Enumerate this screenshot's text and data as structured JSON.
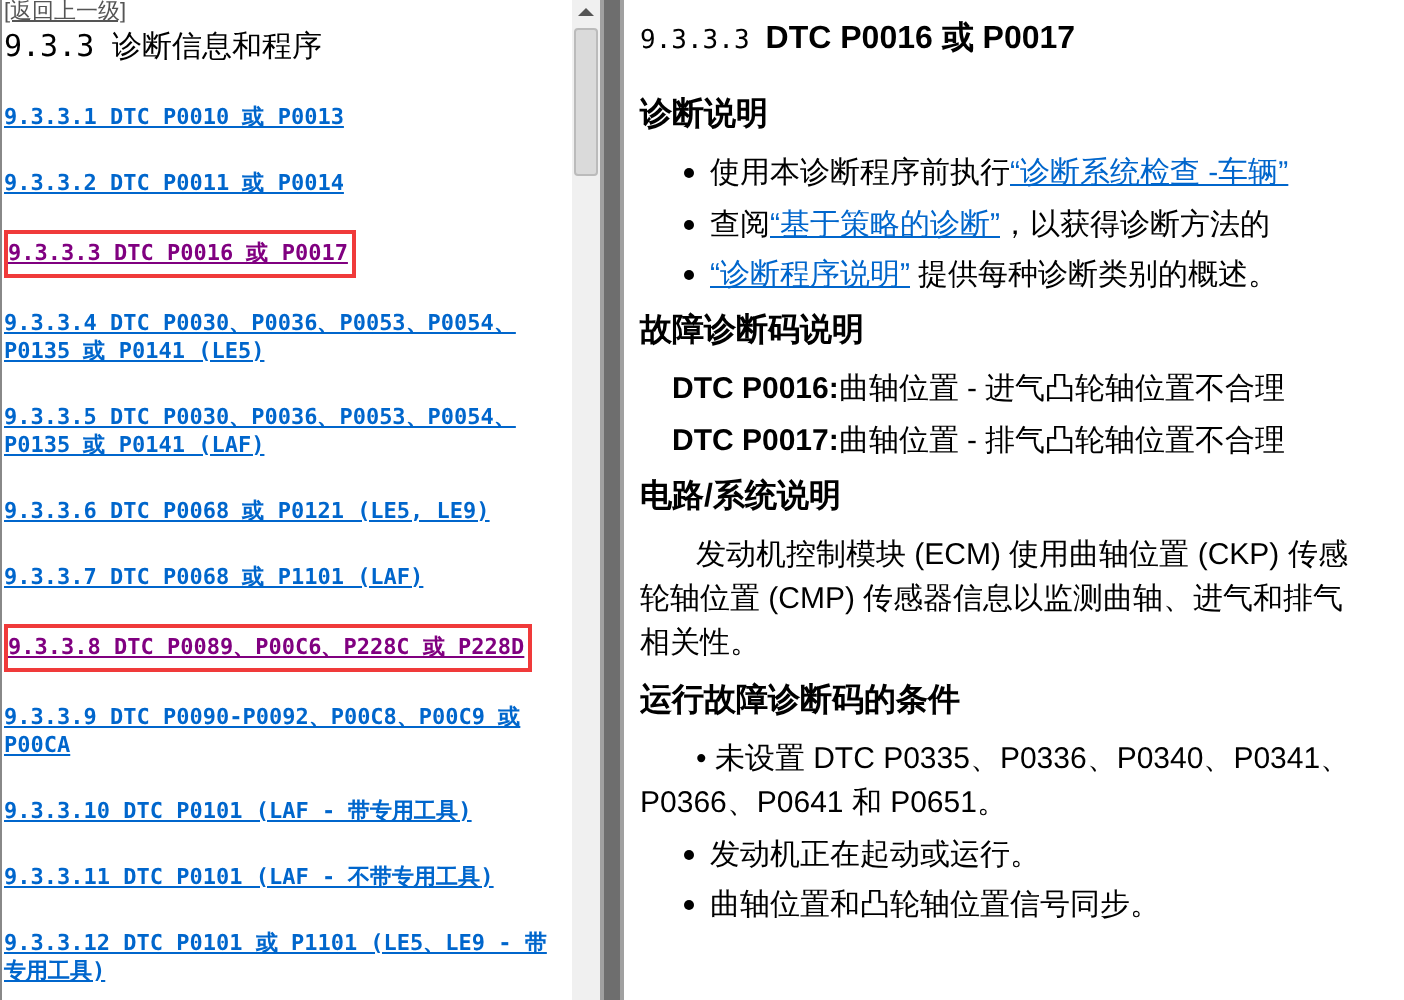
{
  "back_link": "[返回上一级]",
  "toc_title": "9.3.3 诊断信息和程序",
  "toc_items": [
    {
      "label": "9.3.3.1 DTC P0010 或 P0013",
      "selected": false
    },
    {
      "label": "9.3.3.2 DTC P0011 或 P0014",
      "selected": false
    },
    {
      "label": "9.3.3.3 DTC P0016 或 P0017",
      "selected": true
    },
    {
      "label": "9.3.3.4 DTC P0030、P0036、P0053、P0054、P0135 或 P0141 (LE5)",
      "selected": false
    },
    {
      "label": "9.3.3.5 DTC P0030、P0036、P0053、P0054、P0135 或 P0141 (LAF)",
      "selected": false
    },
    {
      "label": "9.3.3.6 DTC P0068 或 P0121 (LE5, LE9)",
      "selected": false
    },
    {
      "label": "9.3.3.7 DTC P0068 或 P1101 (LAF)",
      "selected": false
    },
    {
      "label": "9.3.3.8 DTC P0089、P00C6、P228C 或 P228D",
      "selected": true
    },
    {
      "label": "9.3.3.9 DTC P0090-P0092、P00C8、P00C9 或 P00CA",
      "selected": false
    },
    {
      "label": "9.3.3.10 DTC P0101 (LAF - 带专用工具)",
      "selected": false
    },
    {
      "label": "9.3.3.11 DTC P0101 (LAF - 不带专用工具)",
      "selected": false
    },
    {
      "label": "9.3.3.12 DTC P0101 或 P1101 (LE5、LE9 - 带专用工具)",
      "selected": false
    }
  ],
  "article": {
    "number": "9.3.3.3",
    "title": "DTC P0016 或  P0017",
    "sections": [
      {
        "heading": "诊断说明",
        "blocks": [
          {
            "kind": "bullet",
            "text": "使用本诊断程序前执行",
            "link": "“诊断系统检查 -车辆”"
          },
          {
            "kind": "bullet",
            "text": "查阅",
            "link": "“基于策略的诊断”",
            "after": "，以获得诊断方法的"
          },
          {
            "kind": "bullet",
            "link": "“诊断程序说明”",
            "after": " 提供每种诊断类别的概述。"
          }
        ]
      },
      {
        "heading": "故障诊断码说明",
        "blocks": [
          {
            "kind": "code",
            "code": "DTC P0016:",
            "text": "曲轴位置  - 进气凸轮轴位置不合理"
          },
          {
            "kind": "code",
            "code": "DTC P0017:",
            "text": "曲轴位置  - 排气凸轮轴位置不合理"
          }
        ]
      },
      {
        "heading": "电路/系统说明",
        "blocks": [
          {
            "kind": "para",
            "lines": [
              "发动机控制模块 (ECM) 使用曲轴位置 (CKP) 传感",
              "轮轴位置 (CMP) 传感器信息以监测曲轴、进气和排气",
              "相关性。"
            ]
          }
        ]
      },
      {
        "heading": "运行故障诊断码的条件",
        "blocks": [
          {
            "kind": "para_bullet",
            "lines": [
              "• 未设置 DTC P0335、P0336、P0340、P0341、",
              "P0366、P0641 和 P0651。"
            ]
          },
          {
            "kind": "bullet",
            "text": "发动机正在起动或运行。"
          },
          {
            "kind": "bullet",
            "text": "曲轴位置和凸轮轴位置信号同步。"
          }
        ]
      }
    ]
  }
}
